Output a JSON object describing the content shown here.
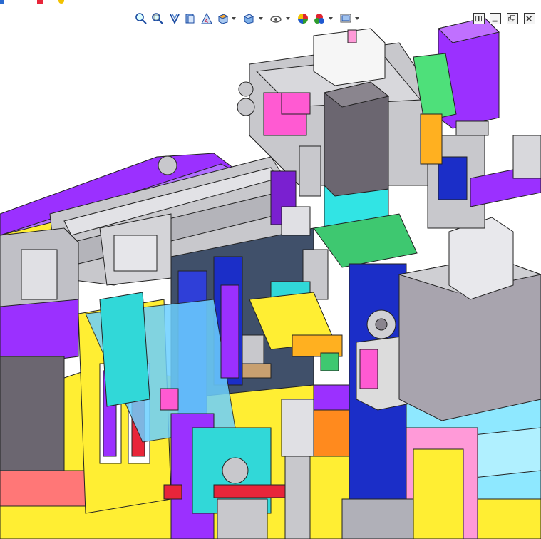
{
  "window": {
    "title": ""
  },
  "heads_up_toolbar": {
    "items": [
      {
        "id": "zoom-to-fit",
        "icon": "zoom-to-fit-icon"
      },
      {
        "id": "zoom-to-area",
        "icon": "zoom-to-area-icon"
      },
      {
        "id": "previous-view",
        "icon": "previous-view-icon"
      },
      {
        "id": "section-view",
        "icon": "section-view-icon"
      },
      {
        "id": "dynamic-annotation",
        "icon": "dynamic-annotation-icon"
      },
      {
        "id": "view-orientation",
        "icon": "view-orientation-icon",
        "dropdown": true
      },
      {
        "id": "display-style",
        "icon": "display-style-icon",
        "dropdown": true
      },
      {
        "id": "hide-show-items",
        "icon": "hide-show-items-icon",
        "dropdown": true
      },
      {
        "id": "edit-appearance",
        "icon": "edit-appearance-icon",
        "dropdown": true
      },
      {
        "id": "apply-scene",
        "icon": "apply-scene-icon",
        "dropdown": true
      },
      {
        "id": "view-settings",
        "icon": "view-settings-icon",
        "dropdown": true
      }
    ]
  },
  "window_controls": [
    {
      "id": "tile-horizontal",
      "icon": "tile-horizontal-icon"
    },
    {
      "id": "minimize",
      "icon": "minimize-icon"
    },
    {
      "id": "restore",
      "icon": "restore-icon"
    },
    {
      "id": "close",
      "icon": "close-icon"
    }
  ],
  "colors": {
    "background": "#ffffff",
    "purple": "#9b30ff",
    "lavender": "#b88cff",
    "yellow": "#ffee33",
    "blue": "#1b2ec8",
    "cyan": "#31d8d8",
    "pink": "#ff5ad2",
    "gray": "#c8c8cc",
    "dark_gray": "#6b6670",
    "green": "#2fe06a",
    "red": "#e8253a",
    "orange": "#ff8a1e"
  }
}
